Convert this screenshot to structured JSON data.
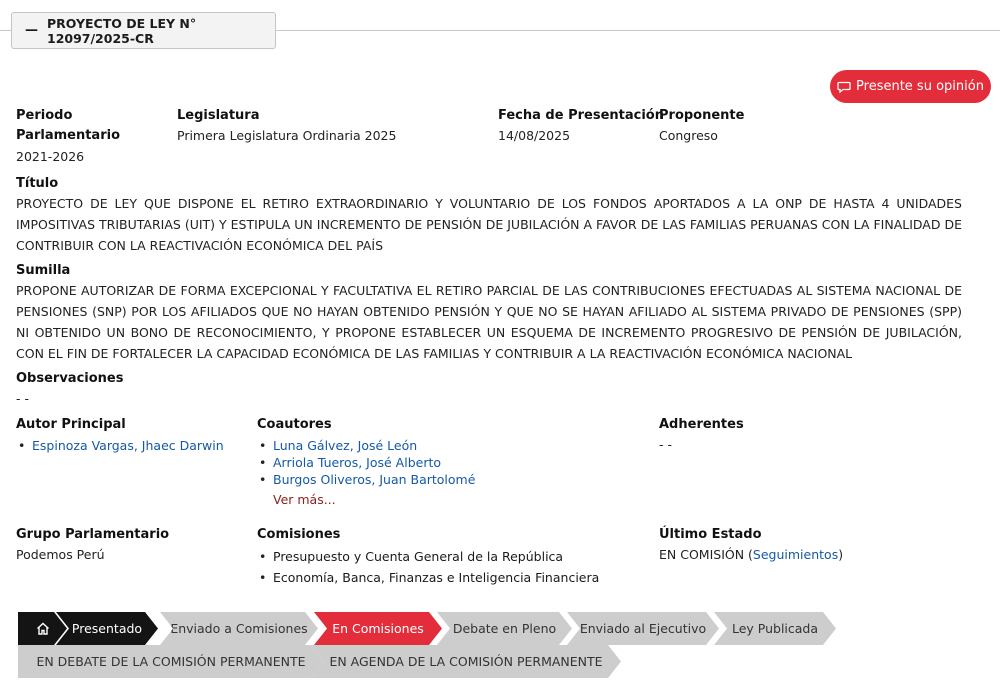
{
  "header": {
    "dash": "—",
    "title": "PROYECTO DE LEY N° 12097/2025-CR"
  },
  "opinion_button": {
    "label": "Presente su opinión",
    "icon": "chat-icon"
  },
  "info": {
    "periodo_label_1": "Periodo",
    "periodo_label_2": "Parlamentario",
    "periodo_value": "2021-2026",
    "legislatura_label": "Legislatura",
    "legislatura_value": "Primera Legislatura Ordinaria 2025",
    "fecha_label": "Fecha de Presentación",
    "fecha_value": "14/08/2025",
    "proponente_label": "Proponente",
    "proponente_value": "Congreso"
  },
  "titulo": {
    "label": "Título",
    "text": "PROYECTO DE LEY QUE DISPONE EL RETIRO EXTRAORDINARIO Y VOLUNTARIO DE LOS FONDOS APORTADOS A LA ONP DE HASTA 4 UNIDADES IMPOSITIVAS TRIBUTARIAS (UIT) Y ESTIPULA UN INCREMENTO DE PENSIÓN DE JUBILACIÓN A FAVOR DE LAS FAMILIAS PERUANAS CON LA FINALIDAD DE CONTRIBUIR CON LA REACTIVACIÓN ECONÓMICA DEL PAÍS"
  },
  "sumilla": {
    "label": "Sumilla",
    "text": "PROPONE AUTORIZAR DE FORMA EXCEPCIONAL Y FACULTATIVA EL RETIRO PARCIAL DE LAS CONTRIBUCIONES EFECTUADAS AL SISTEMA NACIONAL DE PENSIONES (SNP) POR LOS AFILIADOS QUE NO HAYAN OBTENIDO PENSIÓN Y QUE NO SE HAYAN AFILIADO AL SISTEMA PRIVADO DE PENSIONES (SPP) NI OBTENIDO UN BONO DE RECONOCIMIENTO, Y PROPONE ESTABLECER UN ESQUEMA DE INCREMENTO PROGRESIVO DE PENSIÓN DE JUBILACIÓN, CON EL FIN DE FORTALECER LA CAPACIDAD ECONÓMICA DE LAS FAMILIAS Y CONTRIBUIR A LA REACTIVACIÓN ECONÓMICA NACIONAL"
  },
  "observaciones": {
    "label": "Observaciones",
    "value": "- -"
  },
  "autor": {
    "label": "Autor Principal",
    "items": [
      "Espinoza Vargas, Jhaec Darwin"
    ]
  },
  "coautores": {
    "label": "Coautores",
    "items": [
      "Luna Gálvez, José León",
      "Arriola Tueros, José Alberto",
      "Burgos Oliveros, Juan Bartolomé"
    ],
    "more": "Ver más..."
  },
  "adherentes": {
    "label": "Adherentes",
    "value": "- -"
  },
  "grupo": {
    "label": "Grupo Parlamentario",
    "value": "Podemos Perú"
  },
  "comisiones": {
    "label": "Comisiones",
    "items": [
      "Presupuesto y Cuenta General de la República",
      "Economía, Banca, Finanzas e Inteligencia Financiera"
    ]
  },
  "estado": {
    "label": "Último Estado",
    "prefix": "EN COMISIÓN (",
    "link": "Seguimientos",
    "suffix": ")"
  },
  "progress": {
    "home_icon": "home-icon",
    "row1": [
      "Presentado",
      "Enviado a Comisiones",
      "En Comisiones",
      "Debate en Pleno",
      "Enviado al Ejecutivo",
      "Ley Publicada"
    ],
    "row2": [
      "EN DEBATE DE LA COMISIÓN PERMANENTE",
      "EN AGENDA DE LA COMISIÓN PERMANENTE"
    ],
    "colors": {
      "completed": "#141414",
      "current": "#e42d3a",
      "pending": "#cdcdcd"
    }
  }
}
